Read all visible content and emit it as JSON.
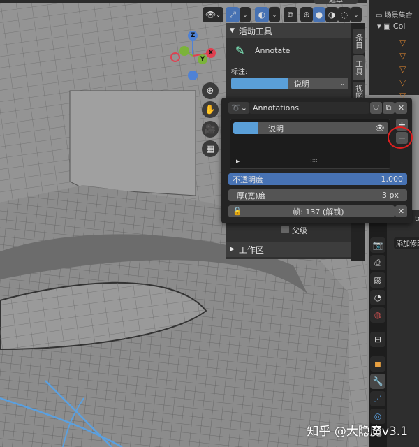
{
  "header": {
    "top_right_label": "遮罩"
  },
  "gizmo": {
    "z": "Z",
    "y": "Y",
    "x": "X"
  },
  "sidebar": {
    "tabs": [
      "条目",
      "工具",
      "视图"
    ],
    "active_tool": {
      "title": "活动工具",
      "tool_name": "Annotate",
      "label": "标注:",
      "layer_value": "说明"
    },
    "parent_label": "父级",
    "workspace_title": "工作区"
  },
  "popover": {
    "datablock_name": "Annotations",
    "layers": [
      {
        "name": "说明",
        "visible": true
      }
    ],
    "opacity_label": "不透明度",
    "opacity_value": "1.000",
    "thickness_label": "厚(宽)度",
    "thickness_value": "3 px",
    "frame_label": "帧: 137 (解锁)",
    "add_label": "+",
    "remove_label": "−"
  },
  "outliner": {
    "scene_collection": "场景集合",
    "collection": "Col"
  },
  "properties": {
    "add_modifier": "添加修改器",
    "partial_text": "to"
  },
  "watermark": "知乎 @大隐魔v3.1",
  "colors": {
    "accent": "#4772b3",
    "layer_color": "#5a9fd8",
    "highlight_circle": "#e02020"
  }
}
